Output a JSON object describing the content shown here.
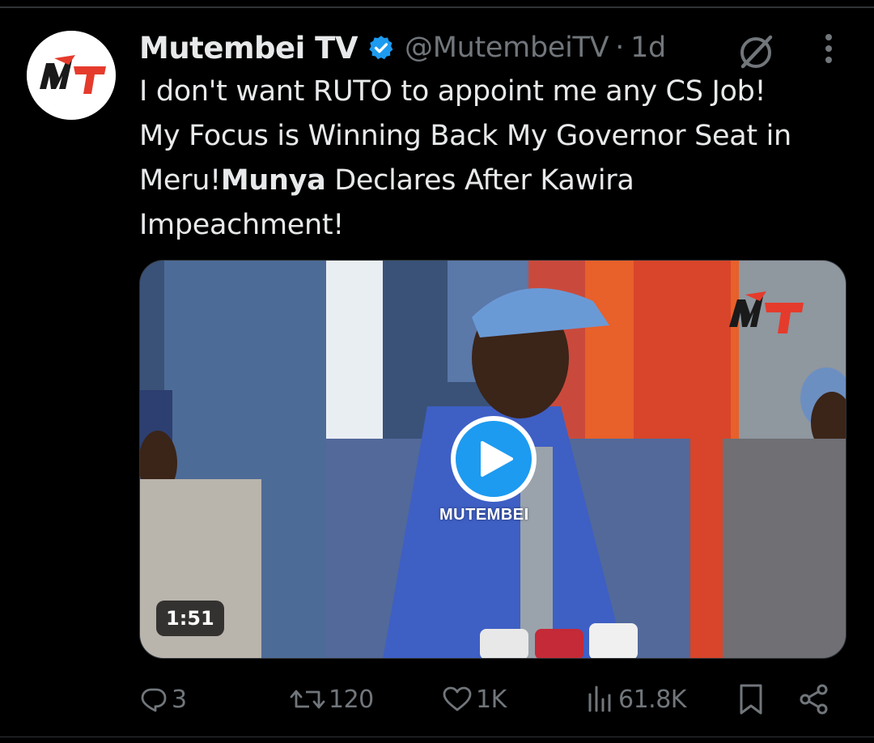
{
  "tweet": {
    "author": {
      "display_name": "Mutembei TV",
      "handle": "@MutembeiTV",
      "separator": "·",
      "time": "1d",
      "verified": true,
      "avatar_logo_text": "M T",
      "avatar_colors": {
        "red": "#e53b2c",
        "dark": "#1a1a1a"
      }
    },
    "text": {
      "line1": "I don't want RUTO to appoint me any CS Job!",
      "line2": "My Focus is Winning Back My Governor Seat in",
      "line3_part1": "Meru!",
      "line3_bold": "Munya",
      "line3_part2": " Declares After Kawira",
      "line4": "Impeachment!"
    },
    "media": {
      "type": "video",
      "duration": "1:51",
      "watermark": "MUTEMBEI",
      "play_icon": "play-icon"
    },
    "actions": {
      "replies": "3",
      "reposts": "120",
      "likes": "1K",
      "views": "61.8K"
    }
  },
  "colors": {
    "background": "#000000",
    "text": "#e7e9ea",
    "muted": "#71767b",
    "accent_blue": "#1d9bf0",
    "divider": "#2f3336"
  },
  "icons": [
    "verified-badge-icon",
    "grok-icon",
    "more-icon",
    "reply-icon",
    "repost-icon",
    "like-icon",
    "views-icon",
    "bookmark-icon",
    "share-icon"
  ]
}
